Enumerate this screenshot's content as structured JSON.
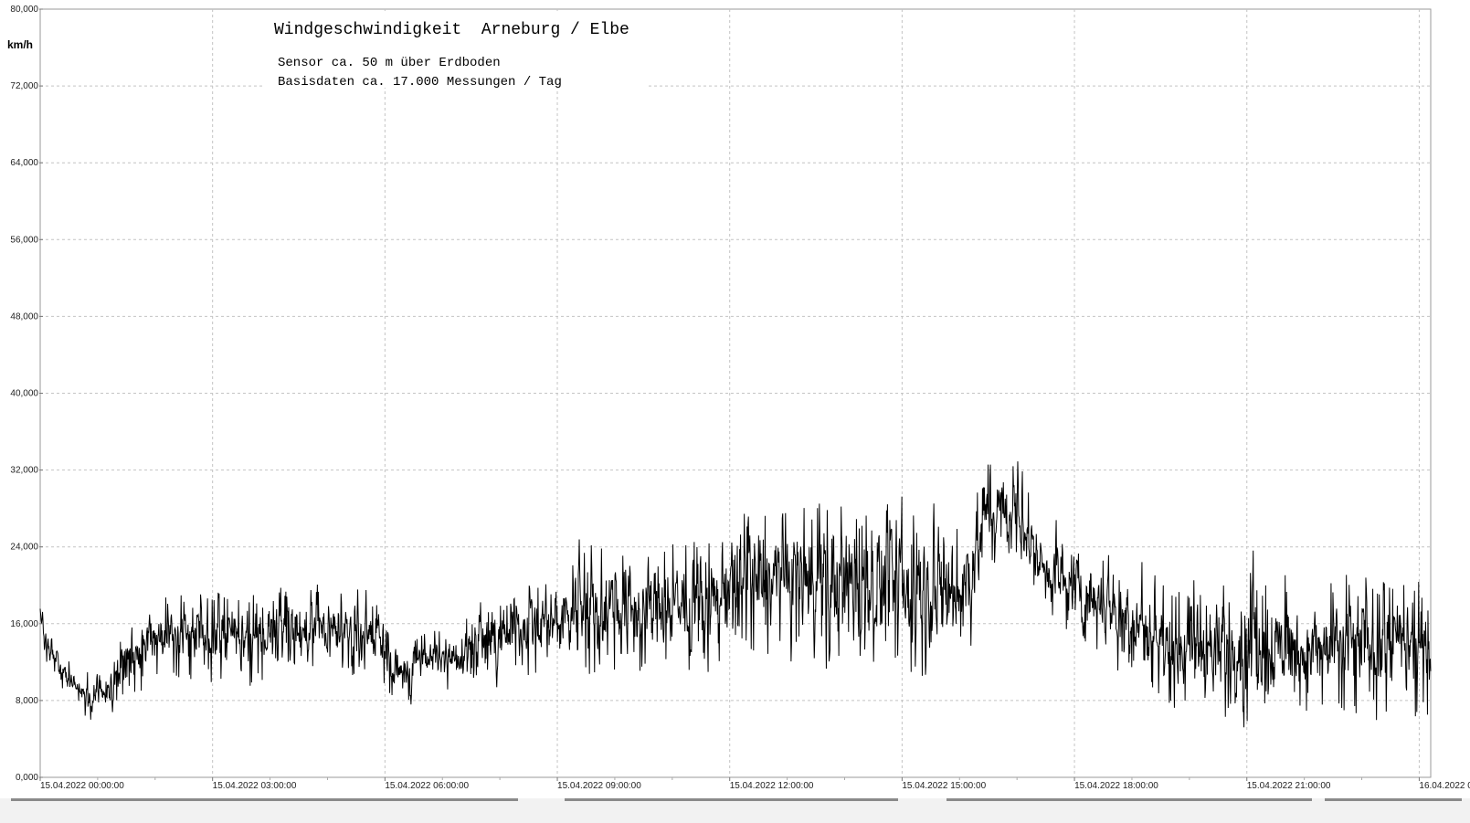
{
  "chart_data": {
    "type": "line",
    "title": "Windgeschwindigkeit  Arneburg / Elbe",
    "subtitle_lines": [
      "Sensor ca. 50 m über Erdboden",
      "Basisdaten ca. 17.000 Messungen / Tag"
    ],
    "ylabel": "km/h",
    "xlabel": "",
    "ylim": [
      0,
      80
    ],
    "xlim_hours": [
      0,
      24.2
    ],
    "yticks": [
      {
        "value": 80,
        "label": "80,000"
      },
      {
        "value": 72,
        "label": "72,000"
      },
      {
        "value": 64,
        "label": "64,000"
      },
      {
        "value": 56,
        "label": "56,000"
      },
      {
        "value": 48,
        "label": "48,000"
      },
      {
        "value": 40,
        "label": "40,000"
      },
      {
        "value": 32,
        "label": "32,000"
      },
      {
        "value": 24,
        "label": "24,000"
      },
      {
        "value": 16,
        "label": "16,000"
      },
      {
        "value": 8,
        "label": "8,000"
      },
      {
        "value": 0,
        "label": "0,000"
      }
    ],
    "xticks": [
      {
        "hour": 0,
        "label": "15.04.2022  00:00:00"
      },
      {
        "hour": 3,
        "label": "15.04.2022  03:00:00"
      },
      {
        "hour": 6,
        "label": "15.04.2022  06:00:00"
      },
      {
        "hour": 9,
        "label": "15.04.2022  09:00:00"
      },
      {
        "hour": 12,
        "label": "15.04.2022  12:00:00"
      },
      {
        "hour": 15,
        "label": "15.04.2022  15:00:00"
      },
      {
        "hour": 18,
        "label": "15.04.2022  18:00:00"
      },
      {
        "hour": 21,
        "label": "15.04.2022  21:00:00"
      },
      {
        "hour": 24,
        "label": "16.04.2022  00:00:00"
      }
    ],
    "grid": true,
    "legend": "none",
    "series": [
      {
        "color": "#000000",
        "envelope_hours": [
          0,
          0.1,
          0.4,
          0.8,
          1.2,
          1.6,
          2.0,
          2.5,
          3.0,
          3.5,
          4.0,
          4.5,
          5.0,
          5.5,
          6.0,
          6.1,
          6.5,
          7.0,
          7.5,
          8.0,
          8.5,
          9.0,
          9.5,
          10.0,
          10.5,
          11.0,
          11.5,
          12.0,
          12.5,
          13.0,
          13.5,
          14.0,
          14.5,
          15.0,
          15.5,
          16.0,
          16.2,
          16.5,
          17.0,
          17.5,
          18.0,
          18.5,
          19.0,
          19.5,
          20.0,
          20.5,
          21.0,
          21.5,
          22.0,
          22.5,
          23.0,
          23.5,
          24.0,
          24.2
        ],
        "envelope_min": [
          14,
          11,
          7,
          5,
          6,
          6,
          8,
          8,
          8,
          7,
          8,
          9,
          9,
          9,
          8,
          6,
          7,
          8,
          8,
          8,
          9,
          9,
          8,
          8,
          7,
          8,
          9,
          10,
          10,
          9,
          8,
          7,
          8,
          7,
          7,
          7,
          10,
          20,
          19,
          15,
          12,
          10,
          8,
          5,
          3,
          3,
          3,
          3,
          4,
          3,
          3,
          3,
          3,
          3
        ],
        "envelope_max": [
          19,
          17,
          14,
          12,
          14,
          20,
          21,
          21,
          22,
          21,
          22,
          21,
          22,
          21,
          20,
          16,
          16,
          17,
          19,
          21,
          23,
          24,
          27,
          27,
          28,
          28,
          28,
          30,
          32,
          32,
          33,
          33,
          33,
          32,
          31,
          30,
          34,
          36,
          35,
          28,
          28,
          27,
          26,
          22,
          24,
          22,
          26,
          25,
          22,
          24,
          25,
          24,
          24,
          23
        ]
      }
    ]
  }
}
